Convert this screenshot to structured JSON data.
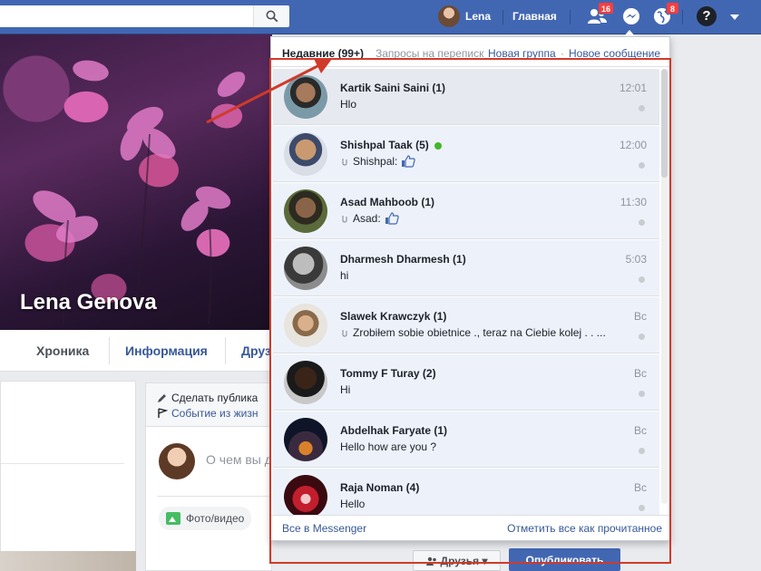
{
  "topbar": {
    "search_placeholder": "",
    "profile_name": "Lena",
    "home_label": "Главная",
    "friend_requests_badge": "16",
    "notifications_badge": "8",
    "help_label": "?"
  },
  "profile": {
    "name": "Lena Genova",
    "tabs": [
      "Хроника",
      "Информация",
      "Друз"
    ]
  },
  "composer": {
    "make_post": "Сделать публика",
    "life_event": "Событие из жизн",
    "placeholder": "О чем вы д",
    "photo_video": "Фото/видео",
    "friends_label": "Друзья ▾",
    "publish_label": "Опубликовать"
  },
  "messenger": {
    "header": {
      "recent": "Недавние (99+)",
      "requests": "Запросы на переписку",
      "new_group": "Новая группа",
      "dot": "·",
      "new_message": "Новое сообщение"
    },
    "conversations": [
      {
        "name": "Kartik Saini Saini (1)",
        "snippet": "Hlo",
        "time": "12:01",
        "online": false,
        "prefix": "",
        "like": false
      },
      {
        "name": "Shishpal Taak (5)",
        "snippet": "Shishpal:",
        "time": "12:00",
        "online": true,
        "prefix": "clip",
        "like": true
      },
      {
        "name": "Asad Mahboob (1)",
        "snippet": "Asad:",
        "time": "11:30",
        "online": false,
        "prefix": "clip",
        "like": true
      },
      {
        "name": "Dharmesh Dharmesh (1)",
        "snippet": "hi",
        "time": "5:03",
        "online": false,
        "prefix": "",
        "like": false
      },
      {
        "name": "Slawek Krawczyk (1)",
        "snippet": "Zrobiłem sobie obietnice ., teraz na Ciebie kolej . . ...",
        "time": "Вс",
        "online": false,
        "prefix": "clip",
        "like": false
      },
      {
        "name": "Tommy F Turay (2)",
        "snippet": "Hi",
        "time": "Вс",
        "online": false,
        "prefix": "",
        "like": false
      },
      {
        "name": "Abdelhak Faryate (1)",
        "snippet": "Hello how are you ?",
        "time": "Вс",
        "online": false,
        "prefix": "",
        "like": false
      },
      {
        "name": "Raja Noman (4)",
        "snippet": "Hello",
        "time": "Вс",
        "online": false,
        "prefix": "",
        "like": false
      }
    ],
    "footer": {
      "see_all": "Все в Messenger",
      "mark_all_read": "Отметить все как прочитанное"
    }
  },
  "colors": {
    "topbar": "#4267b2",
    "annotation": "#d03a2a",
    "online": "#42b72a",
    "badge": "#fa3e3e"
  }
}
